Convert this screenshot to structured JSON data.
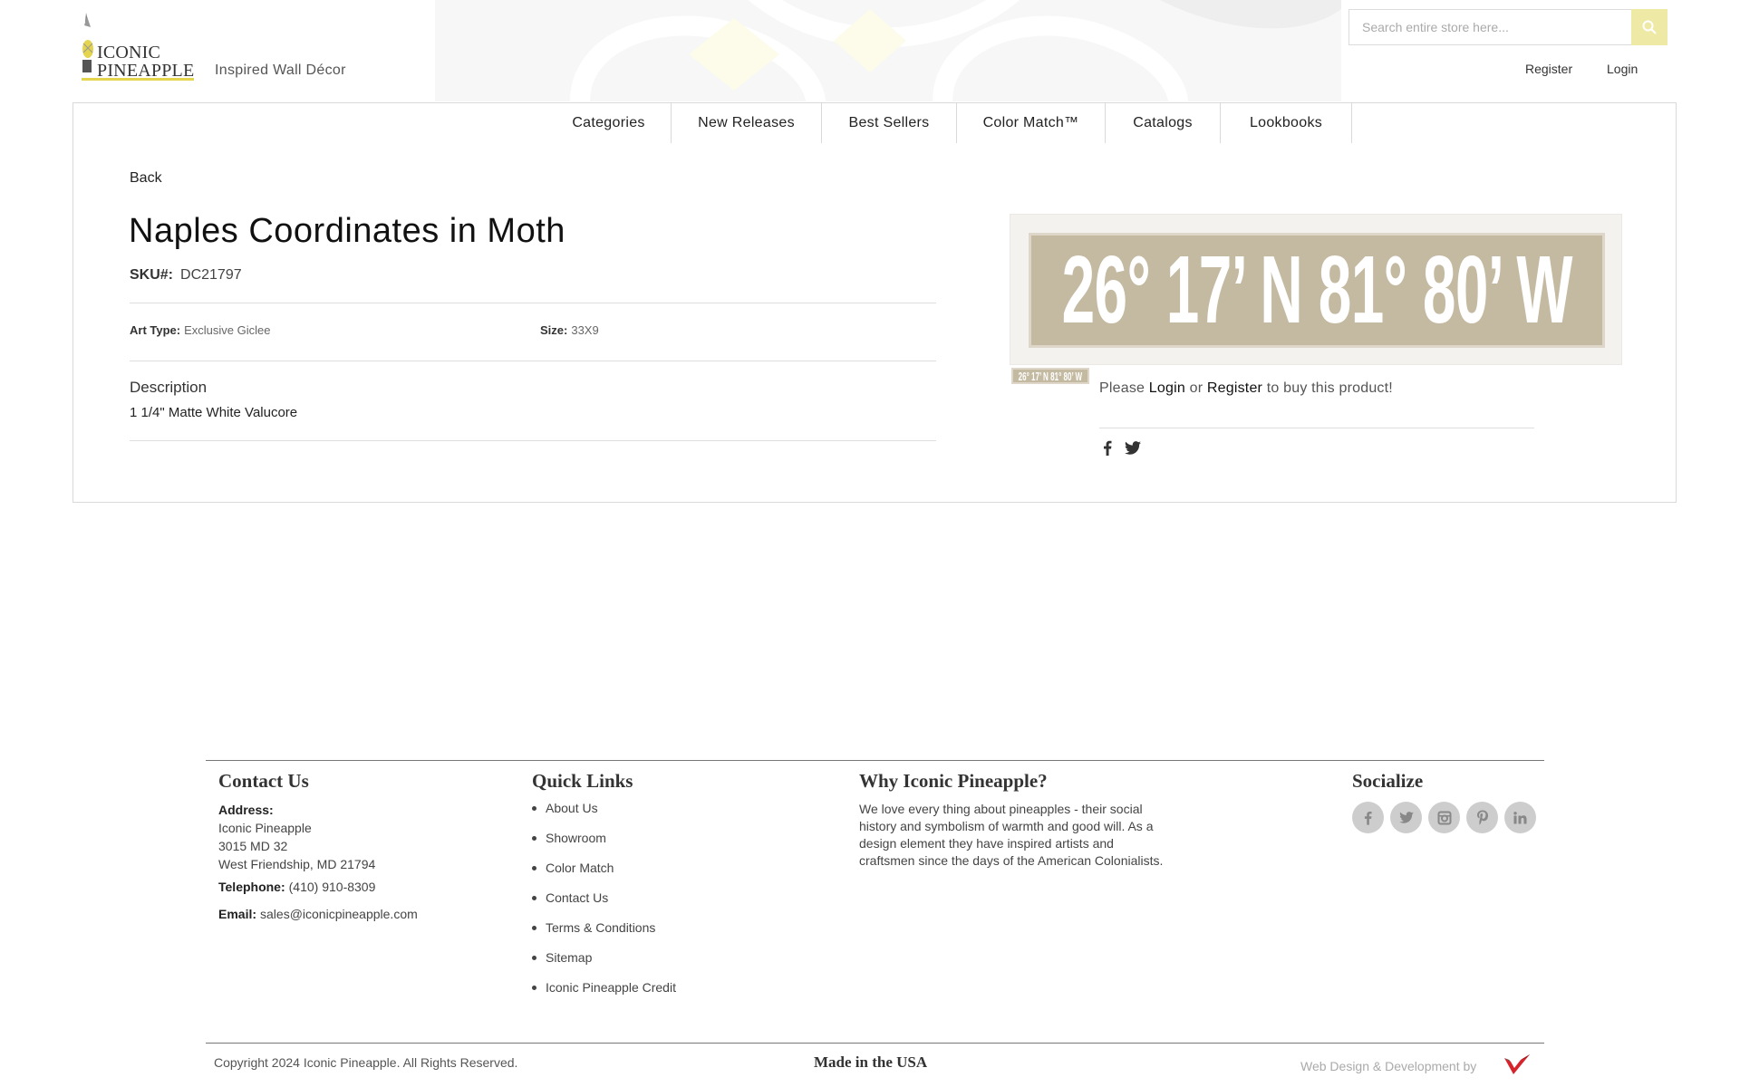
{
  "header": {
    "logo_text_line1": "ICONIC",
    "logo_text_line2": "PINEAPPLE",
    "tagline": "Inspired Wall Décor",
    "search_placeholder": "Search entire store here...",
    "register_label": "Register",
    "login_label": "Login"
  },
  "nav": {
    "items": [
      "Categories",
      "New Releases",
      "Best Sellers",
      "Color Match™",
      "Catalogs",
      "Lookbooks"
    ]
  },
  "product": {
    "back_label": "Back",
    "title": "Naples Coordinates in Moth",
    "sku_label": "SKU#:",
    "sku_value": "DC21797",
    "art_type_label": "Art Type:",
    "art_type_value": "Exclusive Giclee",
    "size_label": "Size:",
    "size_value": "33X9",
    "description_heading": "Description",
    "description_text": "1 1/4\" Matte White Valucore",
    "image_text": "26° 17’ N 81° 80’ W",
    "buy_prefix": "Please",
    "buy_login": "Login",
    "buy_or": "or",
    "buy_register": "Register",
    "buy_suffix": "to buy this product!"
  },
  "footer": {
    "contact_heading": "Contact Us",
    "address_label": "Address:",
    "address_lines": [
      "Iconic Pineapple",
      "3015 MD 32",
      "West Friendship, MD 21794"
    ],
    "telephone_label": "Telephone:",
    "telephone_value": "(410) 910-8309",
    "email_label": "Email:",
    "email_value": "sales@iconicpineapple.com",
    "quick_links_heading": "Quick Links",
    "quick_links": [
      "About Us",
      "Showroom",
      "Color Match",
      "Contact Us",
      "Terms & Conditions",
      "Sitemap",
      "Iconic Pineapple Credit"
    ],
    "why_heading": "Why Iconic Pineapple?",
    "why_text": "We love every thing about pineapples - their social history and symbolism of warmth and good will. As a design element they have inspired artists and craftsmen since the days of the American Colonialists.",
    "socialize_heading": "Socialize",
    "social_icons": [
      "facebook-icon",
      "twitter-icon",
      "instagram-icon",
      "pinterest-icon",
      "linkedin-icon"
    ],
    "copyright": "Copyright 2024 Iconic Pineapple. All Rights Reserved.",
    "made_in": "Made in the USA",
    "credit": "Web Design & Development by"
  },
  "colors": {
    "accent_yellow": "#efe9a6",
    "logo_underline": "#e4d44e",
    "image_background": "#c4b9a1",
    "social_button": "#cdcdcd"
  }
}
